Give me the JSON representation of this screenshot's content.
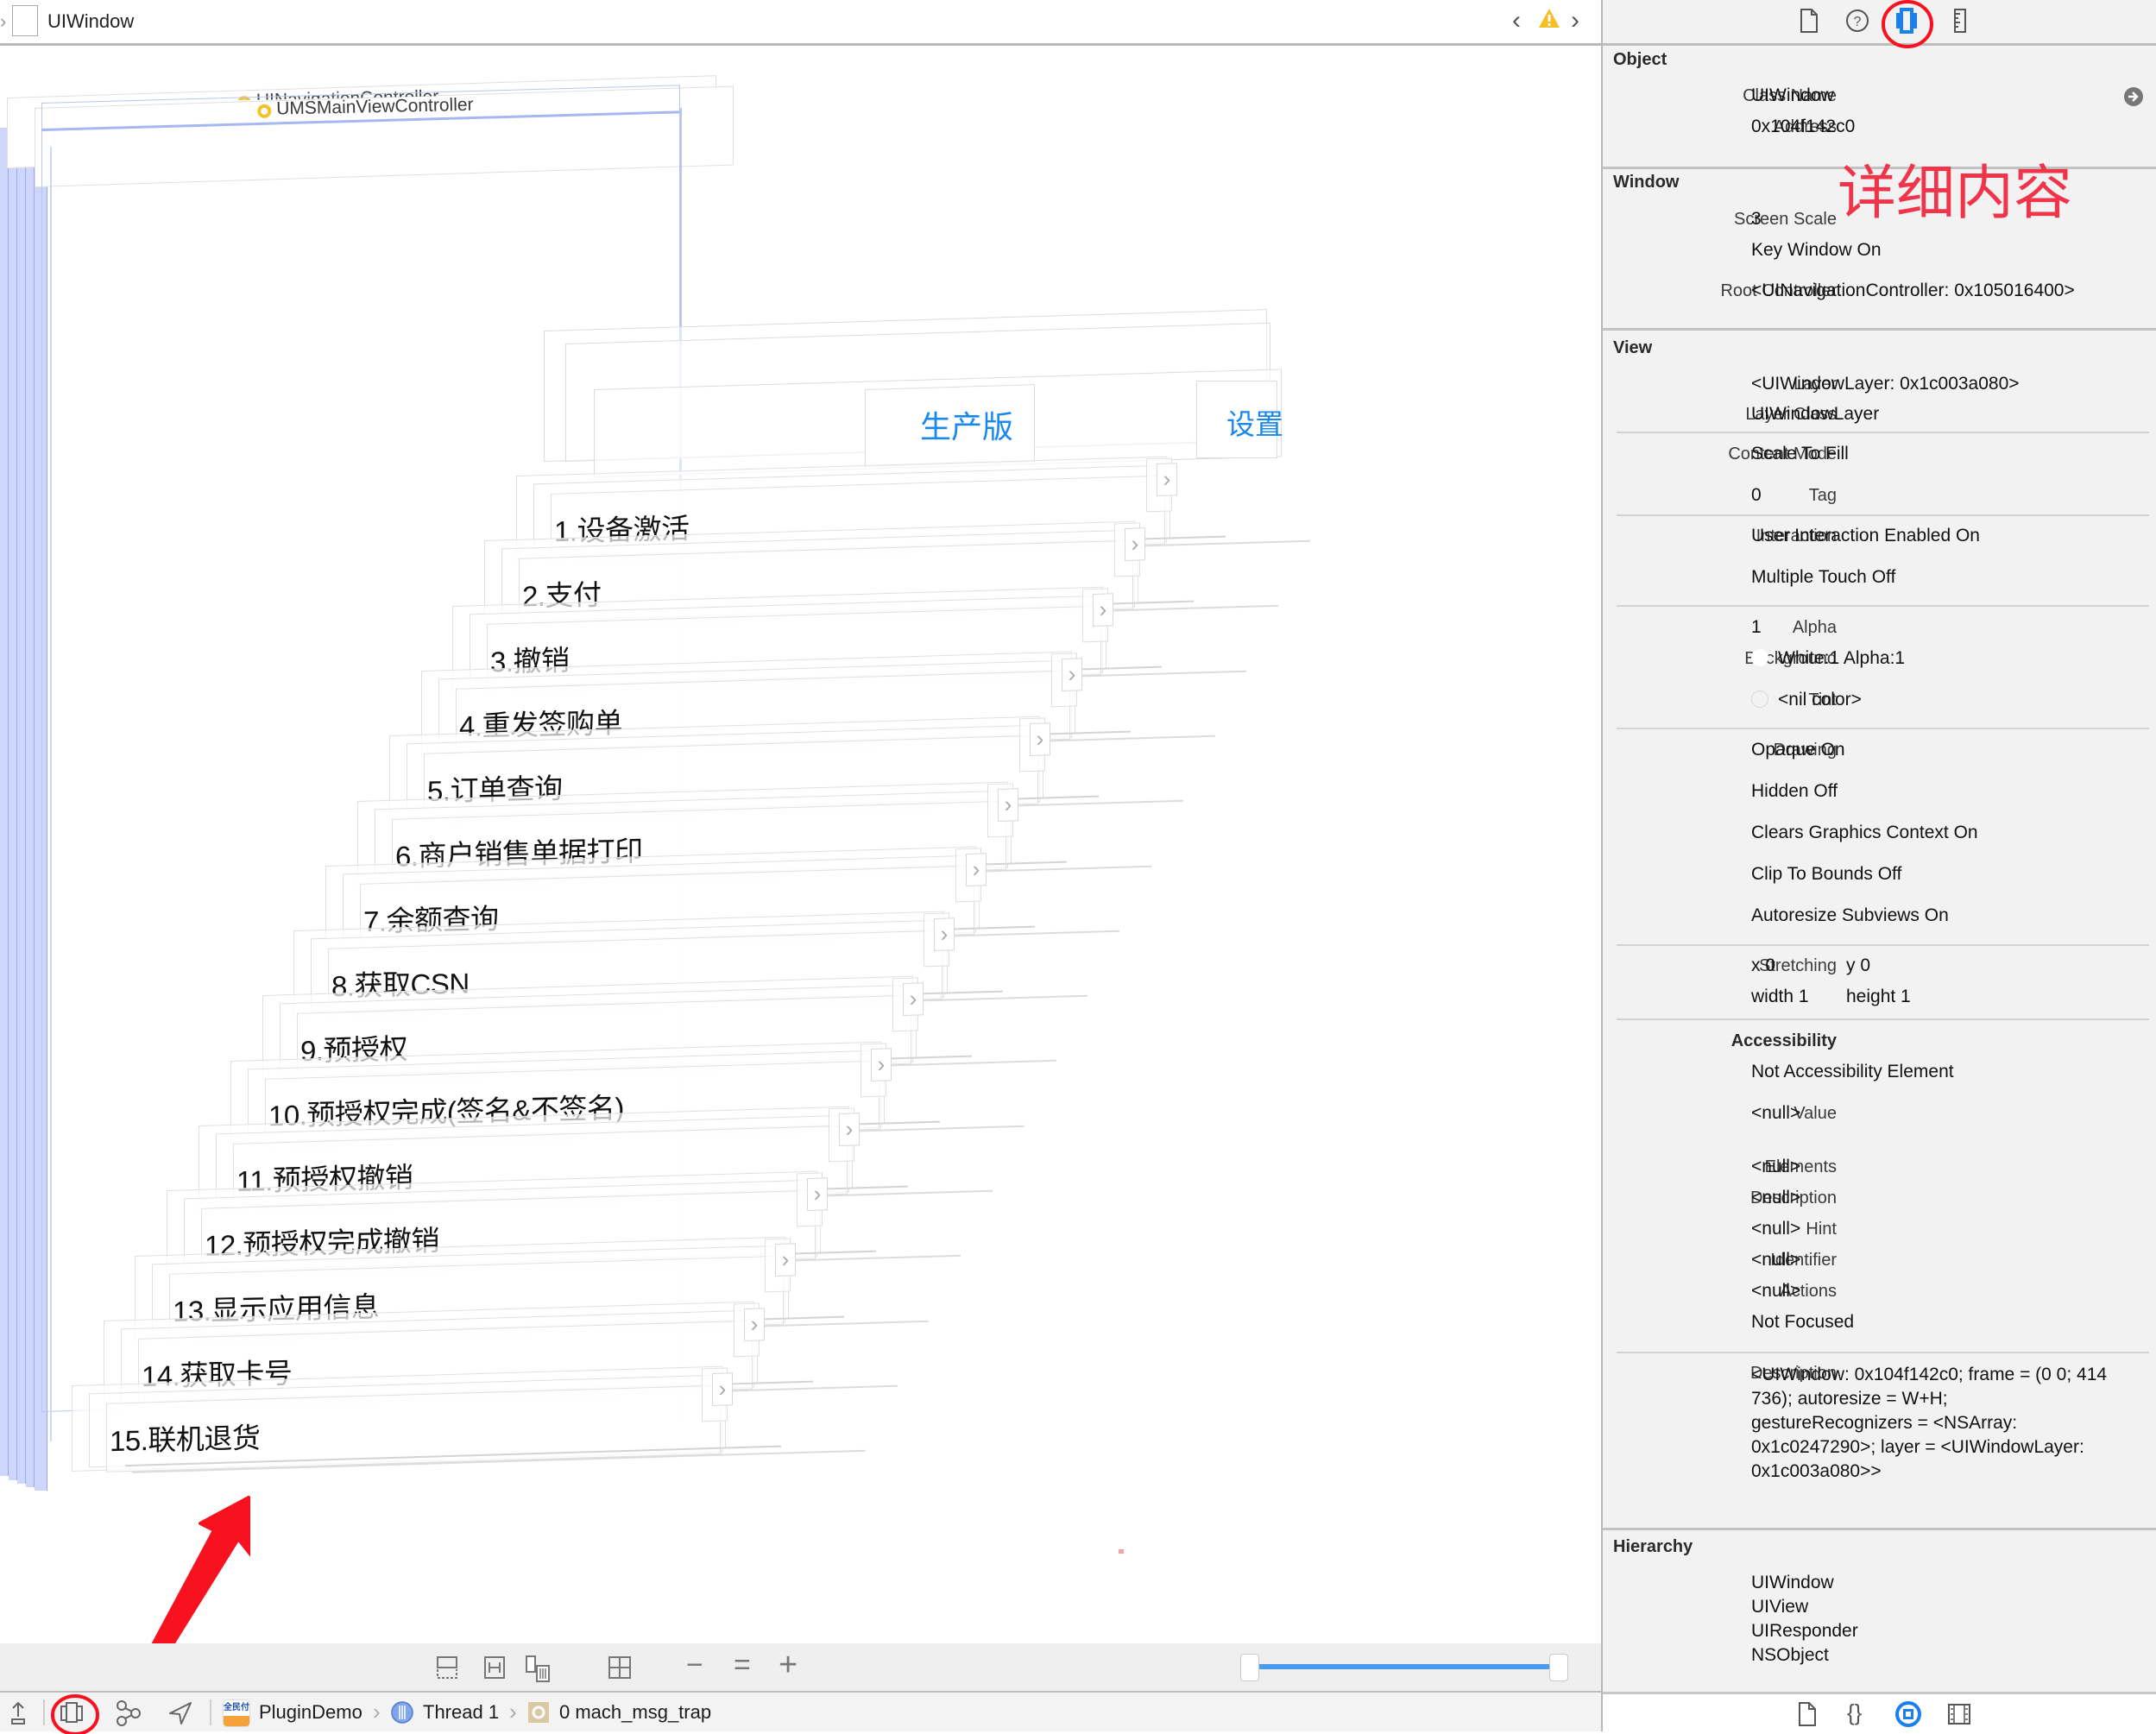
{
  "jumpbar": {
    "title": "UIWindow",
    "back_label": "‹",
    "forward_label": "›",
    "warning_icon": "warning-triangle-icon"
  },
  "canvas": {
    "nav_controller_title": "UINavigationController",
    "main_vc_title": "UMSMainViewController",
    "env_button_label": "生产版",
    "settings_button_label": "设置",
    "disclosure_glyph": "›",
    "menu_items": [
      "1.设备激活",
      "2.支付",
      "3.撤销",
      "4.重发签购单",
      "5.订单查询",
      "6.商户销售单据打印",
      "7.余额查询",
      "8.获取CSN",
      "9.预授权",
      "10.预授权完成(签名&不签名)",
      "11.预授权撤销",
      "12.预授权完成撤销",
      "13.显示应用信息",
      "14.获取卡号",
      "15.联机退货"
    ],
    "colors": {
      "accent_blue": "#1b88f0",
      "selection_blue": "#a7b7f0",
      "annotation_red": "#f0344a"
    }
  },
  "canvas_toolbar": {
    "buttons": [
      {
        "name": "show-clipped-content-button",
        "icon": "clip-icon"
      },
      {
        "name": "show-constraints-button",
        "icon": "constraints-icon"
      },
      {
        "name": "adjust-view-mode-button",
        "icon": "view-mode-icon"
      },
      {
        "name": "orient-3d-button",
        "icon": "grid-icon"
      },
      {
        "name": "zoom-out-button",
        "glyph": "−"
      },
      {
        "name": "zoom-actual-button",
        "glyph": "="
      },
      {
        "name": "zoom-in-button",
        "glyph": "+"
      }
    ],
    "range_slider": {
      "low": 0.0,
      "high": 1.0
    }
  },
  "debug_bar": {
    "app_name": "PluginDemo",
    "thread": "Thread 1",
    "frame": "0 mach_msg_trap",
    "crumb_separator": "›"
  },
  "inspector": {
    "tabs": [
      "file-inspector-icon",
      "quick-help-icon",
      "object-inspector-icon",
      "size-inspector-icon"
    ],
    "annotation": "详细内容",
    "object": {
      "title": "Object",
      "class_name_label": "Class Name",
      "class_name": "UIWindow",
      "address_label": "Address",
      "address": "0x104f142c0"
    },
    "window": {
      "title": "Window",
      "screen_scale_label": "Screen Scale",
      "screen_scale": "3",
      "key_window": "Key Window On",
      "root_controller_label": "Root Controller",
      "root_controller": "<UINavigationController: 0x105016400>"
    },
    "view": {
      "title": "View",
      "layer_label": "Layer",
      "layer": "<UIWindowLayer: 0x1c003a080>",
      "layer_class_label": "Layer Class",
      "layer_class": "UIWindowLayer",
      "content_mode_label": "Content Mode",
      "content_mode": "Scale To Fill",
      "tag_label": "Tag",
      "tag": "0",
      "interaction_label": "Interaction",
      "interaction_enabled": "User Interaction Enabled On",
      "multiple_touch": "Multiple Touch Off",
      "alpha_label": "Alpha",
      "alpha": "1",
      "background_label": "Background",
      "background": "White:1 Alpha:1",
      "background_color": "#ffffff",
      "tint_label": "Tint",
      "tint": "<nil color>",
      "drawing_label": "Drawing",
      "drawing": [
        "Opaque On",
        "Hidden Off",
        "Clears Graphics Context On",
        "Clip To Bounds Off",
        "Autoresize Subviews On"
      ],
      "stretching_label": "Stretching",
      "stretch_x": "x 0",
      "stretch_y": "y 0",
      "stretch_w": "width 1",
      "stretch_h": "height 1"
    },
    "accessibility": {
      "title": "Accessibility",
      "element": "Not Accessibility Element",
      "value_label": "Value",
      "value": "<null>",
      "elements_label": "Elements",
      "elements": "<null>",
      "description_label": "Description",
      "description": "<null>",
      "hint_label": "Hint",
      "hint": "<null>",
      "identifier_label": "Identifier",
      "identifier": "<null>",
      "actions_label": "Actions",
      "actions": "<null>",
      "focus": "Not Focused"
    },
    "description": {
      "label": "Description",
      "lines": [
        "<UIWindow: 0x104f142c0; frame = (0 0; 414",
        "736); autoresize = W+H;",
        "gestureRecognizers = <NSArray:",
        "0x1c0247290>; layer = <UIWindowLayer:",
        "0x1c003a080>>"
      ]
    },
    "hierarchy": {
      "title": "Hierarchy",
      "items": [
        "UIWindow",
        "UIView",
        "UIResponder",
        "NSObject"
      ]
    },
    "bottom_tabs": [
      "file-template-icon",
      "code-snippet-icon",
      "object-library-icon",
      "media-library-icon"
    ]
  }
}
